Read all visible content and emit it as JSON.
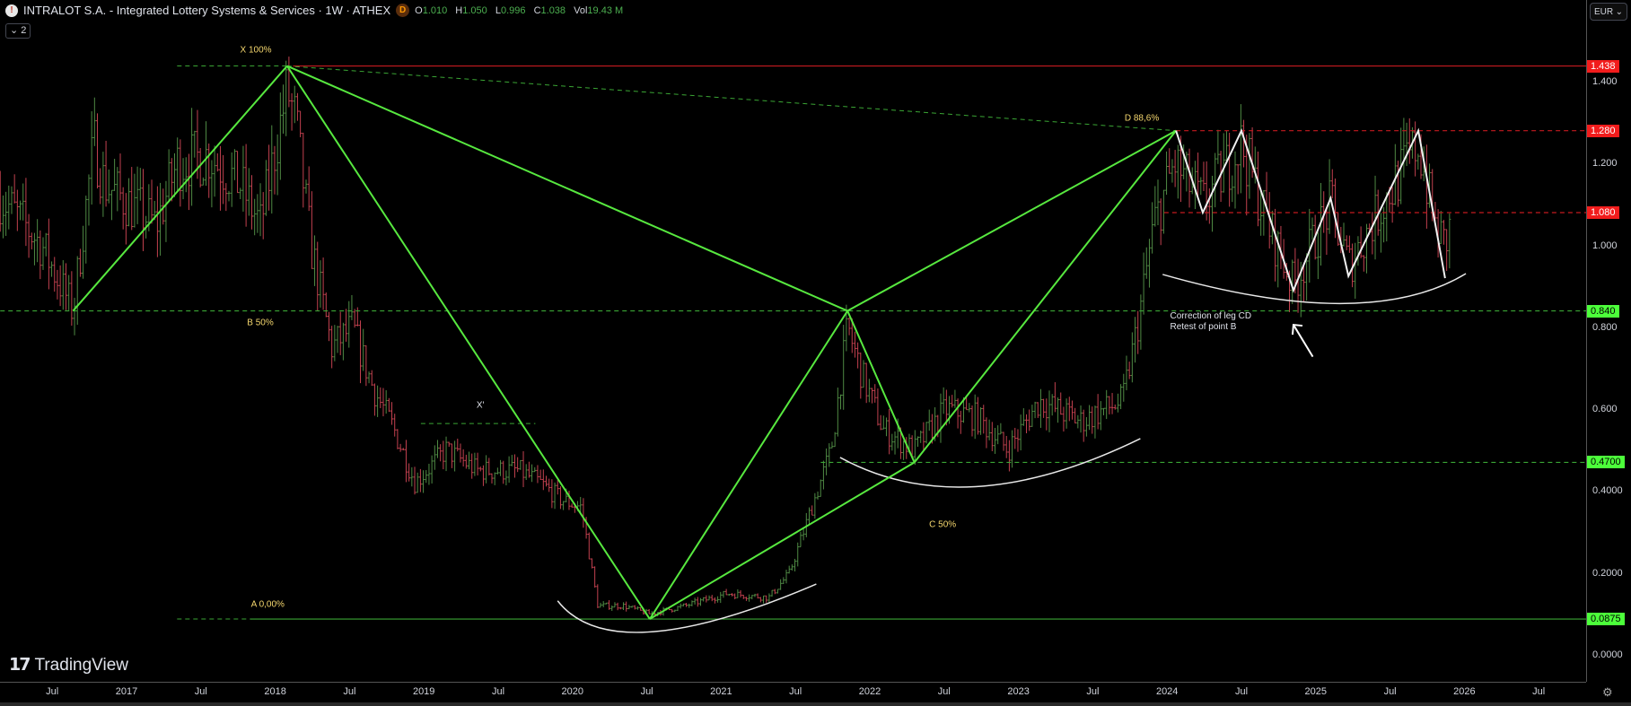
{
  "header": {
    "symbol_icon": "intralot-logo-icon",
    "title": "INTRALOT S.A. - Integrated Lottery Systems & Services · 1W · ATHEX",
    "badge": "D",
    "ohlc": [
      {
        "k": "O",
        "v": "1.010"
      },
      {
        "k": "H",
        "v": "1.050"
      },
      {
        "k": "L",
        "v": "0.996"
      },
      {
        "k": "C",
        "v": "1.038"
      },
      {
        "k": "Vol",
        "v": "19.43 M"
      }
    ],
    "collapse_label": "⌄ 2",
    "currency": "EUR"
  },
  "branding": {
    "logo_mark": "17",
    "logo_text": "TradingView"
  },
  "colors": {
    "pattern": "#57e83f",
    "white_lines": "#f0f0f0",
    "red_level": "#e0242b",
    "green_tag": "#4cff3a",
    "bar_up": "#4f8a44",
    "bar_down": "#c2414f",
    "annotation": "#f5d76e"
  },
  "chart_data": {
    "type": "ohlc",
    "title": "INTRALOT S.A. weekly",
    "ylim": [
      -0.04,
      1.6
    ],
    "xlim": [
      2016.15,
      2026.83
    ],
    "y_ticks": [
      "1.400",
      "1.200",
      "1.000",
      "0.800",
      "0.600",
      "0.4000",
      "0.2000",
      "0.0000"
    ],
    "y_tick_values": [
      1.4,
      1.2,
      1.0,
      0.8,
      0.6,
      0.4,
      0.2,
      0.0
    ],
    "x_ticks": [
      {
        "t": 2016.5,
        "label": "Jul"
      },
      {
        "t": 2017,
        "label": "2017"
      },
      {
        "t": 2017.5,
        "label": "Jul"
      },
      {
        "t": 2018,
        "label": "2018"
      },
      {
        "t": 2018.5,
        "label": "Jul"
      },
      {
        "t": 2019,
        "label": "2019"
      },
      {
        "t": 2019.5,
        "label": "Jul"
      },
      {
        "t": 2020,
        "label": "2020"
      },
      {
        "t": 2020.5,
        "label": "Jul"
      },
      {
        "t": 2021,
        "label": "2021"
      },
      {
        "t": 2021.5,
        "label": "Jul"
      },
      {
        "t": 2022,
        "label": "2022"
      },
      {
        "t": 2022.5,
        "label": "Jul"
      },
      {
        "t": 2023,
        "label": "2023"
      },
      {
        "t": 2023.5,
        "label": "Jul"
      },
      {
        "t": 2024,
        "label": "2024"
      },
      {
        "t": 2024.5,
        "label": "Jul"
      },
      {
        "t": 2025,
        "label": "2025"
      },
      {
        "t": 2025.5,
        "label": "Jul"
      },
      {
        "t": 2026,
        "label": "2026"
      },
      {
        "t": 2026.5,
        "label": "Jul"
      }
    ],
    "price_path": [
      [
        2016.15,
        1.12
      ],
      [
        2016.43,
        1.0
      ],
      [
        2016.64,
        0.84
      ],
      [
        2016.78,
        1.25
      ],
      [
        2016.85,
        1.15
      ],
      [
        2017.2,
        1.05
      ],
      [
        2017.34,
        1.2
      ],
      [
        2017.55,
        1.22
      ],
      [
        2017.76,
        1.15
      ],
      [
        2017.9,
        1.05
      ],
      [
        2018.08,
        1.38
      ],
      [
        2018.14,
        1.3
      ],
      [
        2018.24,
        1.0
      ],
      [
        2018.38,
        0.75
      ],
      [
        2018.52,
        0.8
      ],
      [
        2018.66,
        0.65
      ],
      [
        2018.8,
        0.55
      ],
      [
        2018.94,
        0.42
      ],
      [
        2019.15,
        0.5
      ],
      [
        2019.36,
        0.45
      ],
      [
        2019.5,
        0.45
      ],
      [
        2019.64,
        0.45
      ],
      [
        2019.78,
        0.42
      ],
      [
        2019.92,
        0.38
      ],
      [
        2020.06,
        0.36
      ],
      [
        2020.17,
        0.12
      ],
      [
        2020.34,
        0.12
      ],
      [
        2020.52,
        0.1
      ],
      [
        2020.76,
        0.12
      ],
      [
        2021.04,
        0.15
      ],
      [
        2021.32,
        0.14
      ],
      [
        2021.46,
        0.2
      ],
      [
        2021.6,
        0.35
      ],
      [
        2021.74,
        0.5
      ],
      [
        2021.85,
        0.8
      ],
      [
        2021.95,
        0.68
      ],
      [
        2022.09,
        0.55
      ],
      [
        2022.3,
        0.5
      ],
      [
        2022.51,
        0.6
      ],
      [
        2022.72,
        0.58
      ],
      [
        2022.93,
        0.5
      ],
      [
        2023.14,
        0.62
      ],
      [
        2023.42,
        0.57
      ],
      [
        2023.7,
        0.62
      ],
      [
        2023.8,
        0.8
      ],
      [
        2023.91,
        1.05
      ],
      [
        2024.05,
        1.2
      ],
      [
        2024.24,
        1.1
      ],
      [
        2024.5,
        1.25
      ],
      [
        2024.68,
        1.05
      ],
      [
        2024.85,
        0.9
      ],
      [
        2025.1,
        1.1
      ],
      [
        2025.22,
        0.95
      ],
      [
        2025.45,
        1.1
      ],
      [
        2025.69,
        1.25
      ],
      [
        2025.8,
        1.05
      ],
      [
        2025.87,
        1.0
      ],
      [
        2025.9,
        1.038
      ]
    ],
    "harmonic_points": {
      "start": [
        2016.64,
        0.84
      ],
      "X": [
        2018.08,
        1.438
      ],
      "A": [
        2020.52,
        0.0875
      ],
      "B": [
        2021.85,
        0.84
      ],
      "C": [
        2022.3,
        0.47
      ],
      "D": [
        2024.06,
        1.28
      ]
    },
    "pattern_segments": [
      [
        "start",
        "X"
      ],
      [
        "X",
        "A"
      ],
      [
        "X",
        "B"
      ],
      [
        "A",
        "B"
      ],
      [
        "A",
        "C"
      ],
      [
        "B",
        "C"
      ],
      [
        "B",
        "D"
      ],
      [
        "C",
        "D"
      ]
    ],
    "white_zigzag": [
      [
        2024.06,
        1.28
      ],
      [
        2024.24,
        1.08
      ],
      [
        2024.5,
        1.28
      ],
      [
        2024.85,
        0.89
      ],
      [
        2025.1,
        1.115
      ],
      [
        2025.22,
        0.925
      ],
      [
        2025.69,
        1.28
      ],
      [
        2025.87,
        0.92
      ]
    ],
    "arcs": [
      [
        [
          2019.9,
          0.132
        ],
        [
          2020.52,
          0.056
        ],
        [
          2021.64,
          0.173
        ]
      ],
      [
        [
          2021.8,
          0.482
        ],
        [
          2022.72,
          0.411
        ],
        [
          2023.82,
          0.528
        ]
      ],
      [
        [
          2023.97,
          0.929
        ],
        [
          2025.17,
          0.858
        ],
        [
          2026.01,
          0.931
        ]
      ]
    ],
    "levels": [
      {
        "price": 1.438,
        "label": "1.438",
        "style": "solid",
        "color": "#c41a1f",
        "from": 2018.12,
        "tag_bg": "#f21c1c",
        "tag_fg": "#ffffff"
      },
      {
        "price": 1.28,
        "label": "1.280",
        "style": "dashed",
        "color": "#c41a1f",
        "from": 2024.06,
        "tag_bg": "#f21c1c",
        "tag_fg": "#ffffff"
      },
      {
        "price": 1.08,
        "label": "1.080",
        "style": "dashed",
        "color": "#c41a1f",
        "from": 2023.98,
        "tag_bg": "#f21c1c",
        "tag_fg": "#ffffff"
      },
      {
        "price": 0.84,
        "label": "0.840",
        "style": "dashed",
        "color": "#3aa534",
        "from": 2016.15,
        "tag_bg": "#4cff3a",
        "tag_fg": "#000000"
      },
      {
        "price": 0.47,
        "label": "0.4700",
        "style": "dashed",
        "color": "#3aa534",
        "from": 2021.67,
        "tag_bg": "#4cff3a",
        "tag_fg": "#000000"
      },
      {
        "price": 0.0875,
        "label": "0.0875",
        "style": "solid",
        "color": "#3aa534",
        "from": 2017.83,
        "tag_bg": "#4cff3a",
        "tag_fg": "#000000"
      }
    ],
    "dashed_extras": [
      {
        "from": [
          2017.34,
          1.438
        ],
        "to": [
          2018.08,
          1.438
        ]
      },
      {
        "from": [
          2018.08,
          1.438
        ],
        "to": [
          2024.06,
          1.28
        ]
      },
      {
        "from": [
          2017.34,
          0.0875
        ],
        "to": [
          2017.83,
          0.0875
        ]
      },
      {
        "from": [
          2018.98,
          0.565
        ],
        "to": [
          2019.75,
          0.565
        ]
      }
    ],
    "annotations": [
      {
        "text": "X 100%",
        "t": 2017.87,
        "p": 1.476,
        "color": "#f5d76e"
      },
      {
        "text": "B 50%",
        "t": 2017.9,
        "p": 0.81,
        "color": "#f5d76e"
      },
      {
        "text": "A 0,00%",
        "t": 2017.95,
        "p": 0.122,
        "color": "#f5d76e"
      },
      {
        "text": "C 50%",
        "t": 2022.49,
        "p": 0.317,
        "color": "#f5d76e"
      },
      {
        "text": "D 88,6%",
        "t": 2023.83,
        "p": 1.31,
        "color": "#f5d76e"
      },
      {
        "text": "X'",
        "t": 2019.38,
        "p": 0.608,
        "color": "#e0e3eb"
      }
    ],
    "note": {
      "lines": [
        "Correction of leg CD",
        "Retest of point B"
      ],
      "t": 2024.02,
      "p": 0.826
    },
    "arrow": {
      "from": [
        2024.98,
        0.728
      ],
      "to": [
        2024.85,
        0.806
      ]
    }
  }
}
